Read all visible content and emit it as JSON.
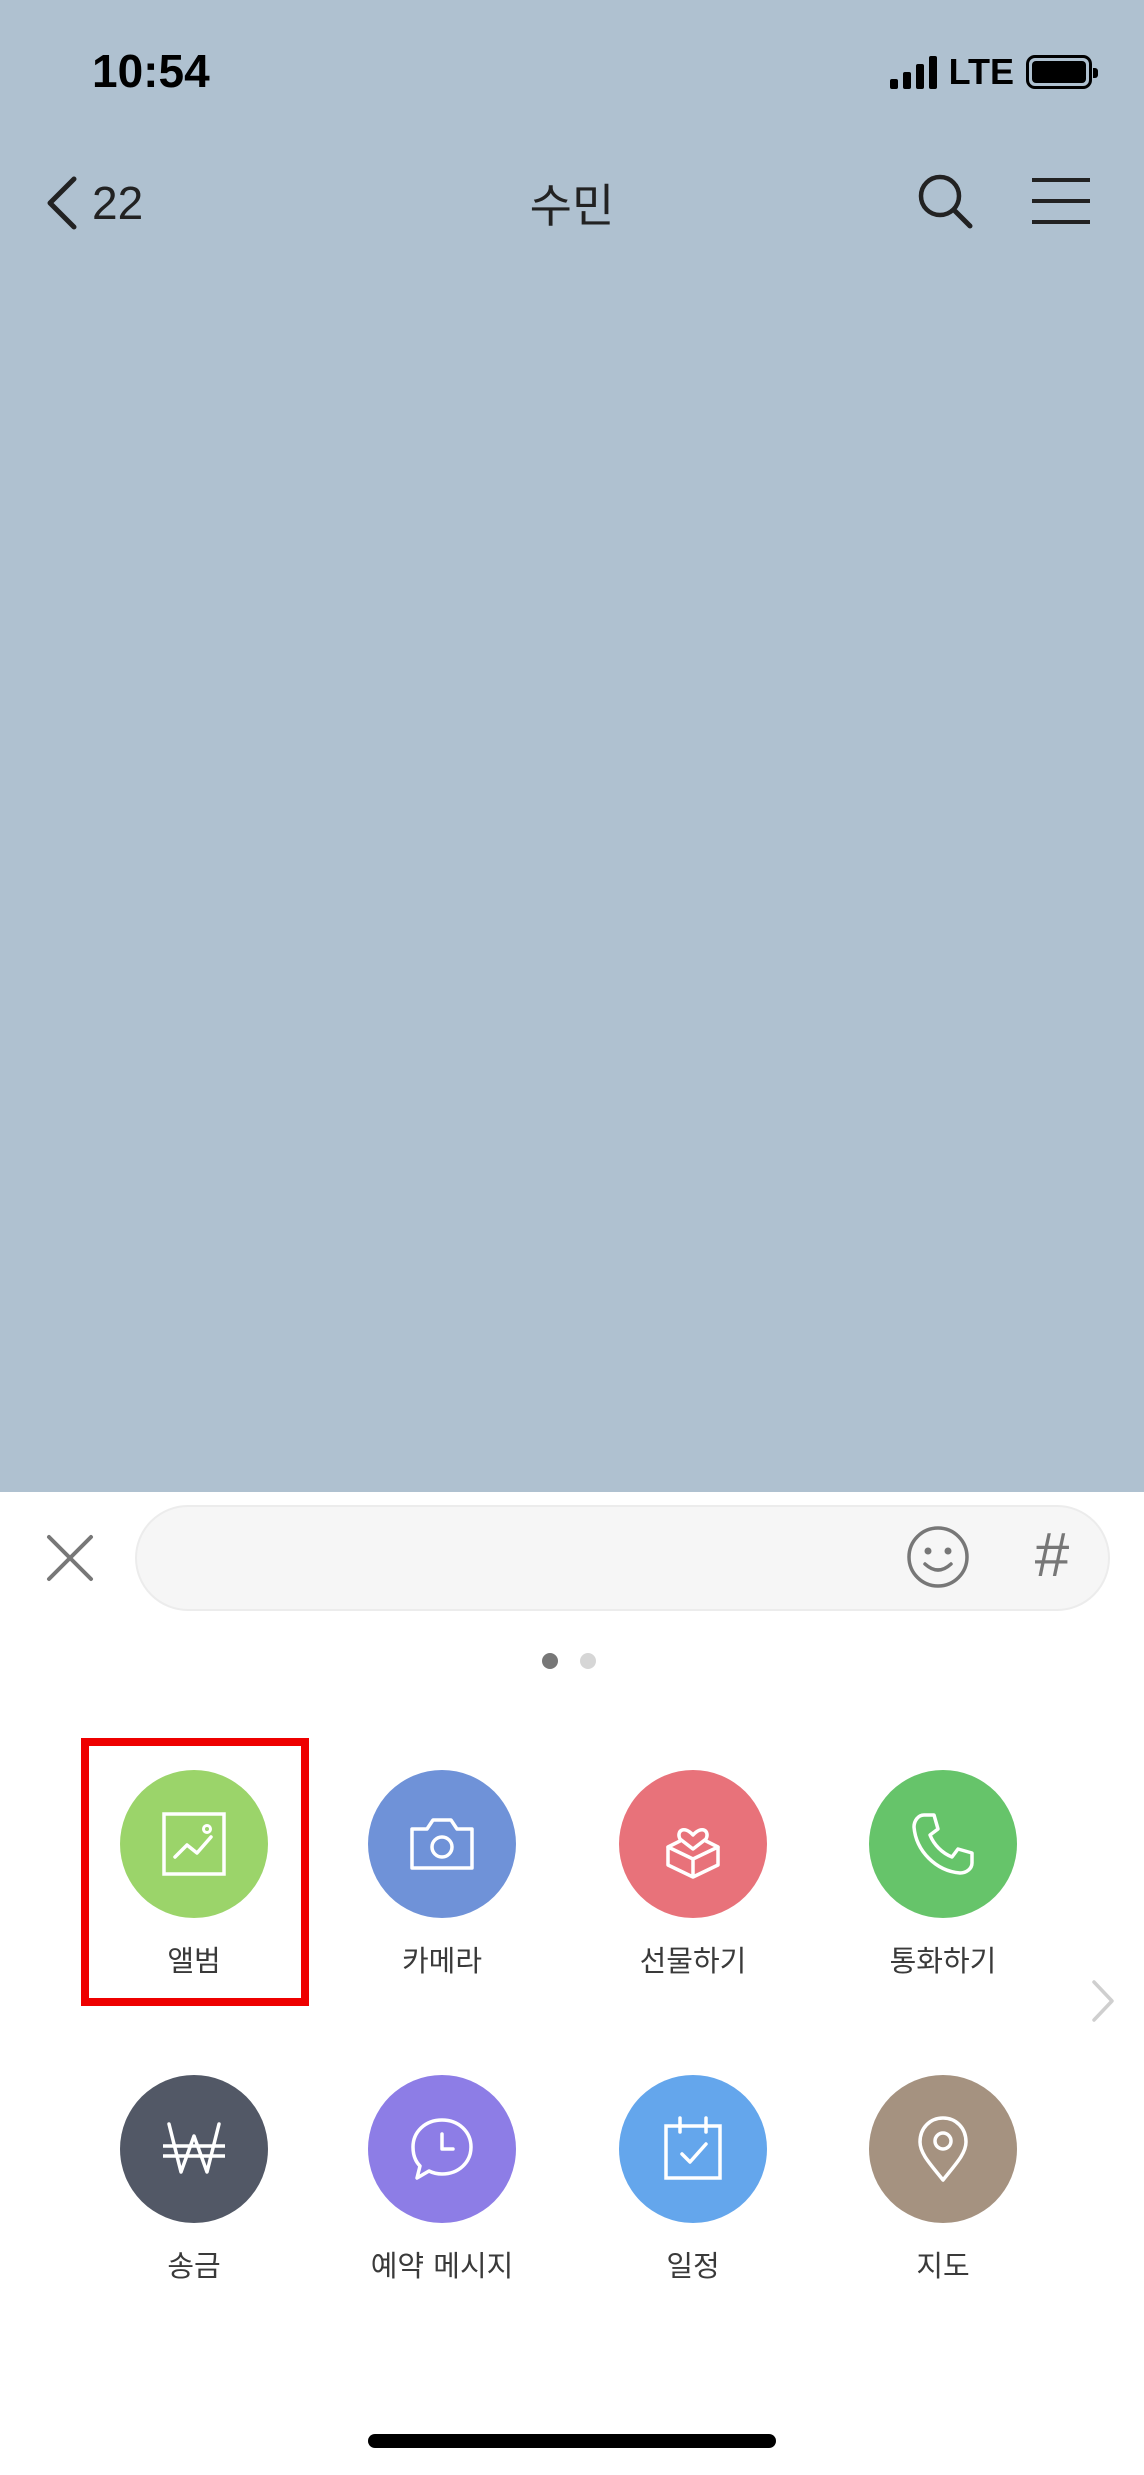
{
  "status_bar": {
    "time": "10:54",
    "network": "LTE",
    "signal_bars": 4,
    "battery_level": 1.0
  },
  "header": {
    "back_count": "22",
    "title": "수민"
  },
  "input_bar": {
    "emoji_icon": "smiley-icon",
    "hash_label": "#"
  },
  "pager": {
    "page_count": 2,
    "current_page": 1
  },
  "apps": [
    {
      "label": "앨범",
      "color": "#9bd46a",
      "icon": "image-icon",
      "highlighted": true
    },
    {
      "label": "카메라",
      "color": "#6f92d8",
      "icon": "camera-icon"
    },
    {
      "label": "선물하기",
      "color": "#e8727a",
      "icon": "gift-icon"
    },
    {
      "label": "통화하기",
      "color": "#66c46a",
      "icon": "phone-icon"
    },
    {
      "label": "송금",
      "color": "#525866",
      "icon": "won-icon"
    },
    {
      "label": "예약 메시지",
      "color": "#8d7de6",
      "icon": "scheduled-message-icon"
    },
    {
      "label": "일정",
      "color": "#64a6ec",
      "icon": "calendar-icon"
    },
    {
      "label": "지도",
      "color": "#a59280",
      "icon": "map-pin-icon"
    }
  ],
  "colors": {
    "chat_background": "#afc1d0",
    "highlight": "#ee0000"
  }
}
